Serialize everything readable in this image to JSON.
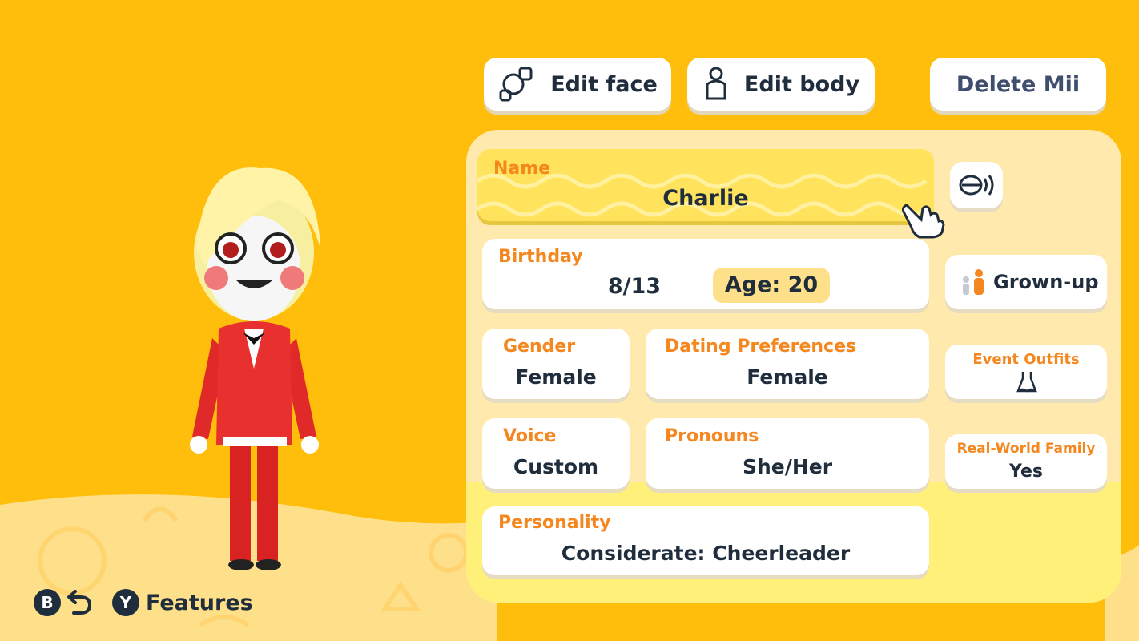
{
  "header": {
    "edit_face_label": "Edit face",
    "edit_body_label": "Edit body",
    "delete_label": "Delete Mii"
  },
  "profile": {
    "name_label": "Name",
    "name_value": "Charlie",
    "birthday_label": "Birthday",
    "birthday_value": "8/13",
    "age_value": "Age: 20",
    "gender_label": "Gender",
    "gender_value": "Female",
    "dating_label": "Dating Preferences",
    "dating_value": "Female",
    "voice_label": "Voice",
    "voice_value": "Custom",
    "pronouns_label": "Pronouns",
    "pronouns_value": "She/Her",
    "personality_label": "Personality",
    "personality_value": "Considerate: Cheerleader"
  },
  "side": {
    "stage_label": "Grown-up",
    "event_outfits_label": "Event Outfits",
    "family_label": "Real-World Family",
    "family_value": "Yes"
  },
  "footer": {
    "b_key": "B",
    "y_key": "Y",
    "features_label": "Features"
  },
  "colors": {
    "background": "#FFBE0B",
    "accent_label": "#F5871F",
    "text_dark": "#1F2D3D",
    "panel": "#FFE9AC",
    "name_field": "#FFE35C"
  }
}
